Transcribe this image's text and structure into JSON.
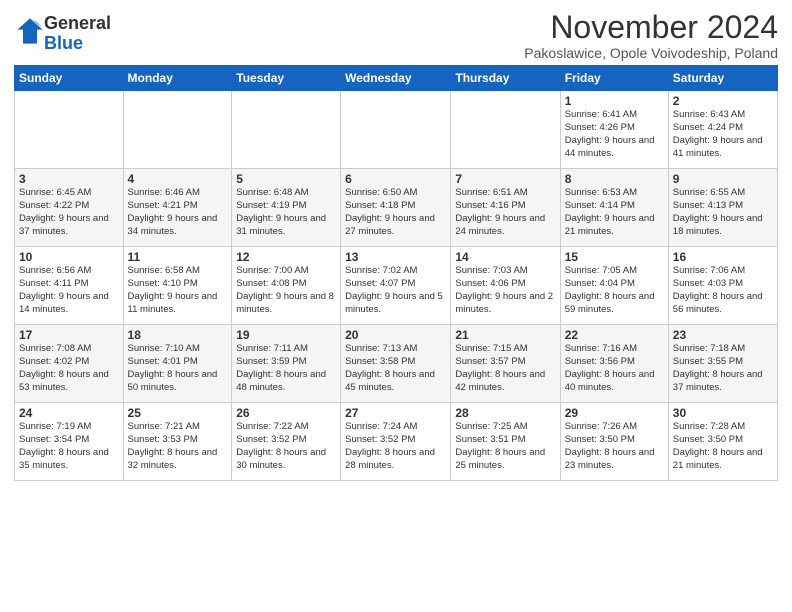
{
  "logo": {
    "general": "General",
    "blue": "Blue"
  },
  "header": {
    "month": "November 2024",
    "location": "Pakoslawice, Opole Voivodeship, Poland"
  },
  "weekdays": [
    "Sunday",
    "Monday",
    "Tuesday",
    "Wednesday",
    "Thursday",
    "Friday",
    "Saturday"
  ],
  "weeks": [
    [
      {
        "day": "",
        "info": ""
      },
      {
        "day": "",
        "info": ""
      },
      {
        "day": "",
        "info": ""
      },
      {
        "day": "",
        "info": ""
      },
      {
        "day": "",
        "info": ""
      },
      {
        "day": "1",
        "info": "Sunrise: 6:41 AM\nSunset: 4:26 PM\nDaylight: 9 hours\nand 44 minutes."
      },
      {
        "day": "2",
        "info": "Sunrise: 6:43 AM\nSunset: 4:24 PM\nDaylight: 9 hours\nand 41 minutes."
      }
    ],
    [
      {
        "day": "3",
        "info": "Sunrise: 6:45 AM\nSunset: 4:22 PM\nDaylight: 9 hours\nand 37 minutes."
      },
      {
        "day": "4",
        "info": "Sunrise: 6:46 AM\nSunset: 4:21 PM\nDaylight: 9 hours\nand 34 minutes."
      },
      {
        "day": "5",
        "info": "Sunrise: 6:48 AM\nSunset: 4:19 PM\nDaylight: 9 hours\nand 31 minutes."
      },
      {
        "day": "6",
        "info": "Sunrise: 6:50 AM\nSunset: 4:18 PM\nDaylight: 9 hours\nand 27 minutes."
      },
      {
        "day": "7",
        "info": "Sunrise: 6:51 AM\nSunset: 4:16 PM\nDaylight: 9 hours\nand 24 minutes."
      },
      {
        "day": "8",
        "info": "Sunrise: 6:53 AM\nSunset: 4:14 PM\nDaylight: 9 hours\nand 21 minutes."
      },
      {
        "day": "9",
        "info": "Sunrise: 6:55 AM\nSunset: 4:13 PM\nDaylight: 9 hours\nand 18 minutes."
      }
    ],
    [
      {
        "day": "10",
        "info": "Sunrise: 6:56 AM\nSunset: 4:11 PM\nDaylight: 9 hours\nand 14 minutes."
      },
      {
        "day": "11",
        "info": "Sunrise: 6:58 AM\nSunset: 4:10 PM\nDaylight: 9 hours\nand 11 minutes."
      },
      {
        "day": "12",
        "info": "Sunrise: 7:00 AM\nSunset: 4:08 PM\nDaylight: 9 hours\nand 8 minutes."
      },
      {
        "day": "13",
        "info": "Sunrise: 7:02 AM\nSunset: 4:07 PM\nDaylight: 9 hours\nand 5 minutes."
      },
      {
        "day": "14",
        "info": "Sunrise: 7:03 AM\nSunset: 4:06 PM\nDaylight: 9 hours\nand 2 minutes."
      },
      {
        "day": "15",
        "info": "Sunrise: 7:05 AM\nSunset: 4:04 PM\nDaylight: 8 hours\nand 59 minutes."
      },
      {
        "day": "16",
        "info": "Sunrise: 7:06 AM\nSunset: 4:03 PM\nDaylight: 8 hours\nand 56 minutes."
      }
    ],
    [
      {
        "day": "17",
        "info": "Sunrise: 7:08 AM\nSunset: 4:02 PM\nDaylight: 8 hours\nand 53 minutes."
      },
      {
        "day": "18",
        "info": "Sunrise: 7:10 AM\nSunset: 4:01 PM\nDaylight: 8 hours\nand 50 minutes."
      },
      {
        "day": "19",
        "info": "Sunrise: 7:11 AM\nSunset: 3:59 PM\nDaylight: 8 hours\nand 48 minutes."
      },
      {
        "day": "20",
        "info": "Sunrise: 7:13 AM\nSunset: 3:58 PM\nDaylight: 8 hours\nand 45 minutes."
      },
      {
        "day": "21",
        "info": "Sunrise: 7:15 AM\nSunset: 3:57 PM\nDaylight: 8 hours\nand 42 minutes."
      },
      {
        "day": "22",
        "info": "Sunrise: 7:16 AM\nSunset: 3:56 PM\nDaylight: 8 hours\nand 40 minutes."
      },
      {
        "day": "23",
        "info": "Sunrise: 7:18 AM\nSunset: 3:55 PM\nDaylight: 8 hours\nand 37 minutes."
      }
    ],
    [
      {
        "day": "24",
        "info": "Sunrise: 7:19 AM\nSunset: 3:54 PM\nDaylight: 8 hours\nand 35 minutes."
      },
      {
        "day": "25",
        "info": "Sunrise: 7:21 AM\nSunset: 3:53 PM\nDaylight: 8 hours\nand 32 minutes."
      },
      {
        "day": "26",
        "info": "Sunrise: 7:22 AM\nSunset: 3:52 PM\nDaylight: 8 hours\nand 30 minutes."
      },
      {
        "day": "27",
        "info": "Sunrise: 7:24 AM\nSunset: 3:52 PM\nDaylight: 8 hours\nand 28 minutes."
      },
      {
        "day": "28",
        "info": "Sunrise: 7:25 AM\nSunset: 3:51 PM\nDaylight: 8 hours\nand 25 minutes."
      },
      {
        "day": "29",
        "info": "Sunrise: 7:26 AM\nSunset: 3:50 PM\nDaylight: 8 hours\nand 23 minutes."
      },
      {
        "day": "30",
        "info": "Sunrise: 7:28 AM\nSunset: 3:50 PM\nDaylight: 8 hours\nand 21 minutes."
      }
    ]
  ]
}
